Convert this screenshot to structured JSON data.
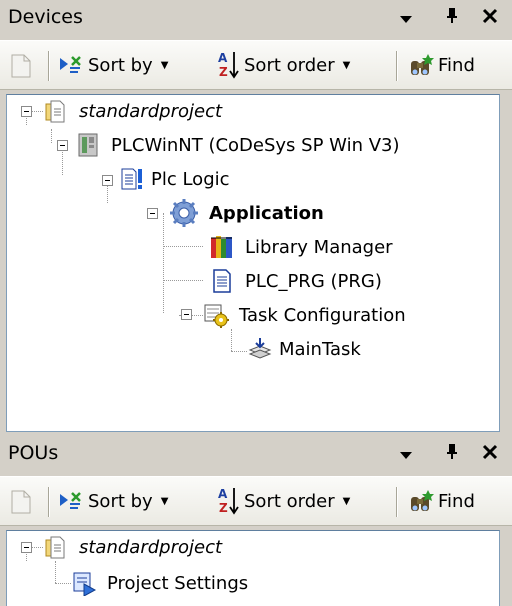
{
  "devices": {
    "title": "Devices",
    "toolbar": {
      "sort_by": "Sort by",
      "sort_order": "Sort order",
      "find": "Find"
    },
    "tree": {
      "root": "standardproject",
      "device": "PLCWinNT (CoDeSys SP Win V3)",
      "plc_logic": "Plc Logic",
      "application": "Application",
      "library_manager": "Library Manager",
      "plc_prg": "PLC_PRG (PRG)",
      "task_configuration": "Task Configuration",
      "main_task": "MainTask"
    }
  },
  "pous": {
    "title": "POUs",
    "toolbar": {
      "sort_by": "Sort by",
      "sort_order": "Sort order",
      "find": "Find"
    },
    "tree": {
      "root": "standardproject",
      "project_settings": "Project Settings"
    }
  },
  "colors": {
    "panel_bg": "#d4d0c8",
    "tree_border": "#7f9db9",
    "tree_bg": "#ffffff"
  }
}
